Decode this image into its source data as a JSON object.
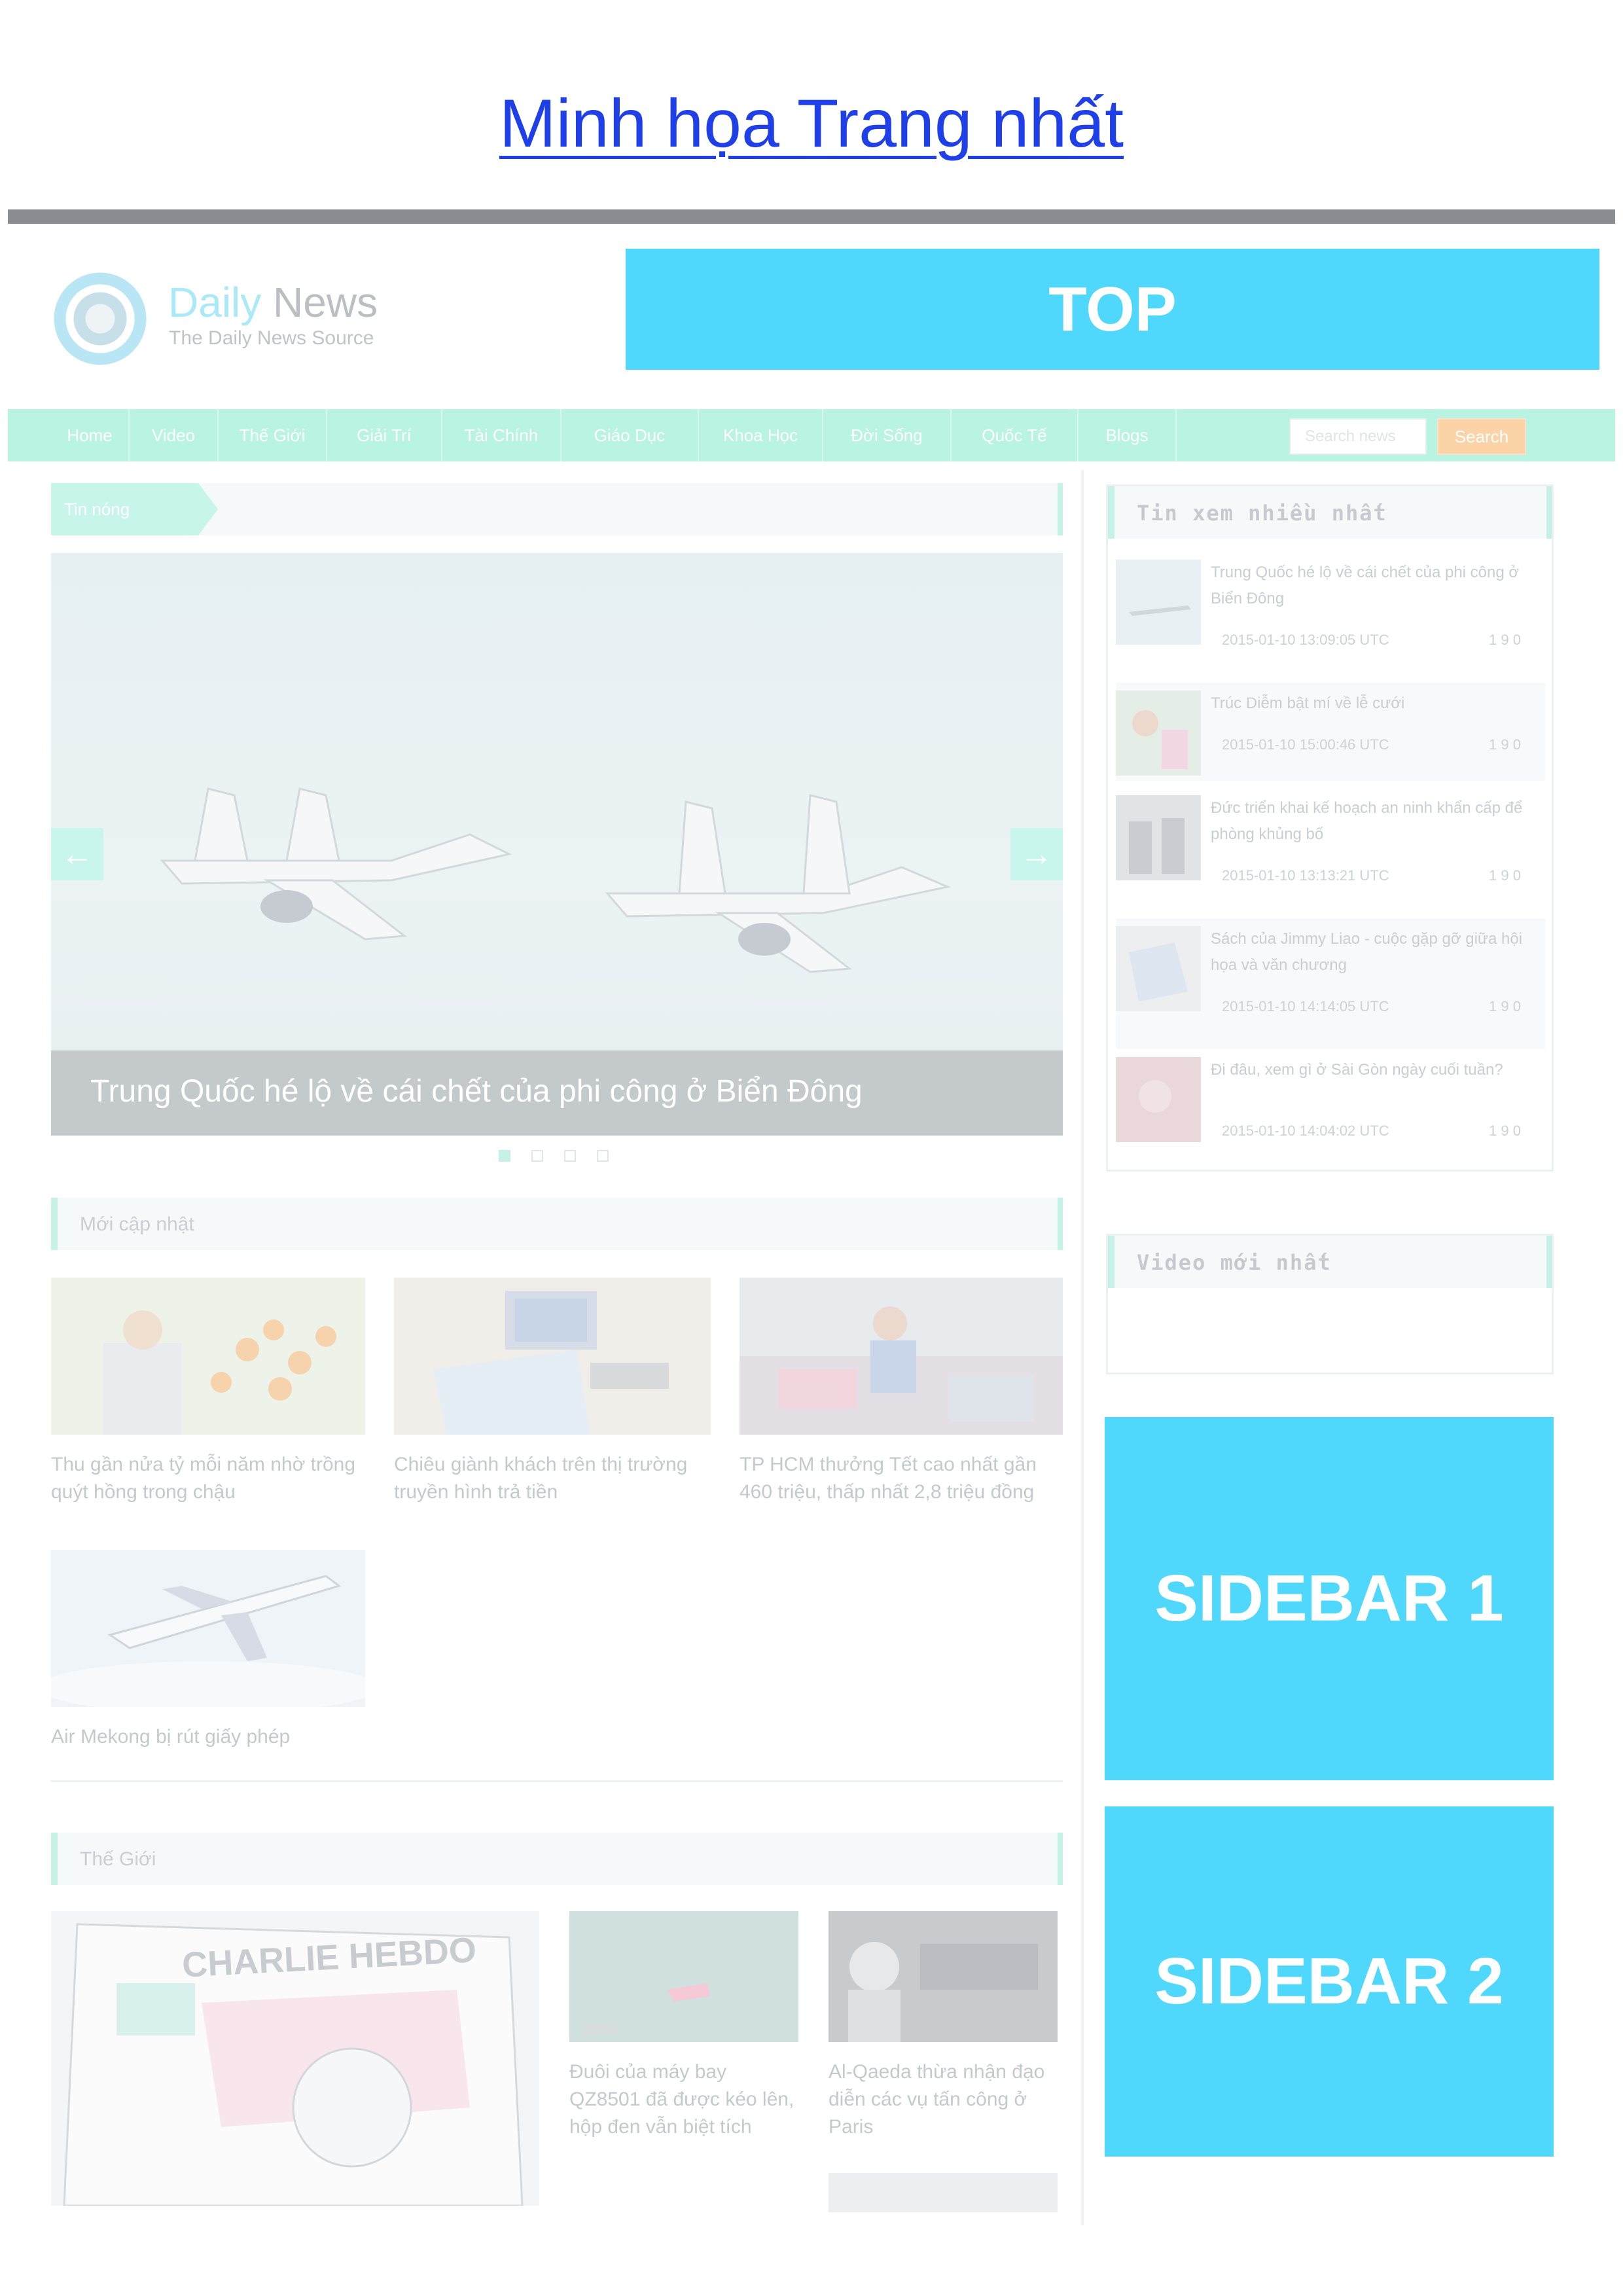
{
  "doc_title": "Minh họa Trang nhất",
  "brand": {
    "name_part1": "Daily",
    "name_part2": "News",
    "tagline": "The Daily News Source"
  },
  "top_box": "TOP",
  "nav": {
    "items": [
      "Home",
      "Video",
      "Thế Giới",
      "Giải Trí",
      "Tài Chính",
      "Giáo Dục",
      "Khoa Học",
      "Đời Sống",
      "Quốc Tế",
      "Blogs"
    ],
    "search_placeholder": "Search news",
    "search_button": "Search"
  },
  "hot": {
    "label": "Tin nóng",
    "caption": "Trung Quốc hé lộ về cái chết của phi công ở Biển Đông",
    "prev": "←",
    "next": "→"
  },
  "latest": {
    "label": "Mới cập nhật",
    "items": [
      "Thu gần nửa tỷ mỗi năm nhờ trồng quýt hồng trong chậu",
      "Chiêu giành khách trên thị trường truyền hình trả tiền",
      "TP HCM thưởng Tết cao nhất gần 460 triệu, thấp nhất 2,8 triệu đồng",
      "Air Mekong bị rút giấy phép"
    ]
  },
  "world": {
    "label": "Thế Giới",
    "items": [
      "Đuôi của máy bay QZ8501 đã được kéo lên, hộp đen vẫn biệt tích",
      "Al-Qaeda thừa nhận đạo diễn các vụ tấn công ở Paris"
    ],
    "magazine_title": "CHARLIE HEBDO"
  },
  "most_viewed": {
    "label": "Tin xem nhiều nhất",
    "items": [
      {
        "title": "Trung Quốc hé lộ về cái chết của phi công ở Biển Đông",
        "date": "2015-01-10 13:09:05 UTC",
        "count": "1 9 0"
      },
      {
        "title": "Trúc Diễm bật mí về lễ cưới",
        "date": "2015-01-10 15:00:46 UTC",
        "count": "1 9 0"
      },
      {
        "title": "Đức triển khai kế hoạch an ninh khẩn cấp để phòng khủng bố",
        "date": "2015-01-10 13:13:21 UTC",
        "count": "1 9 0"
      },
      {
        "title": "Sách của Jimmy Liao - cuộc gặp gỡ giữa hội họa và văn chương",
        "date": "2015-01-10 14:14:05 UTC",
        "count": "1 9 0"
      },
      {
        "title": "Đi đâu, xem gì ở Sài Gòn ngày cuối tuần?",
        "date": "2015-01-10 14:04:02 UTC",
        "count": "1 9 0"
      }
    ]
  },
  "video": {
    "label": "Video mới nhất"
  },
  "sidebar1": "SIDEBAR 1",
  "sidebar2": "SIDEBAR 2",
  "colors": {
    "accent": "#4fd7fc",
    "nav": "#b8f4e1",
    "link": "#1f3fe8",
    "search_btn": "#fcd3a6"
  }
}
